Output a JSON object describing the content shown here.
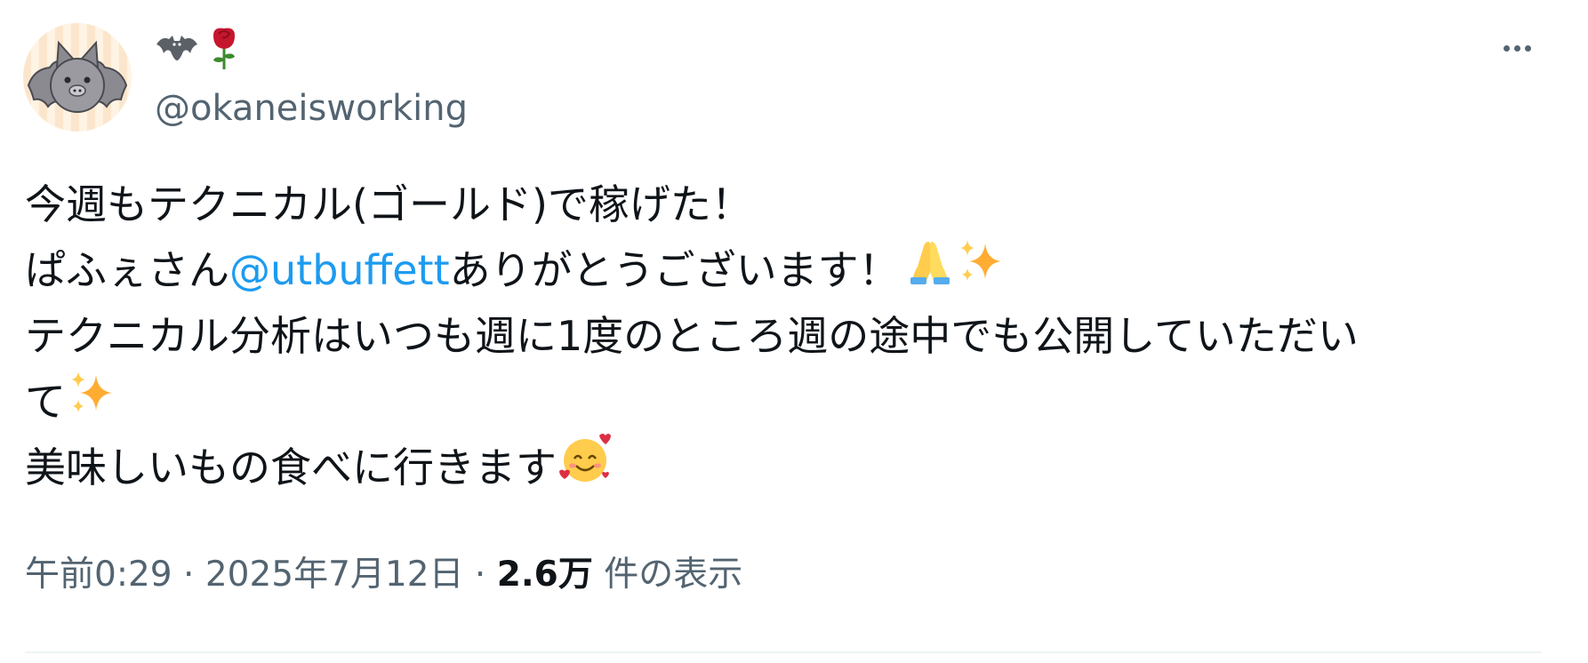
{
  "author": {
    "display_emoji": [
      "bat-emoji",
      "rose-emoji"
    ],
    "handle": "@okaneisworking",
    "avatar": "bat-avatar"
  },
  "tweet": {
    "line1": "今週もテクニカル(ゴールド)で稼げた！",
    "line2_prefix": "ぱふぇさん",
    "line2_mention": "@utbuffett",
    "line2_suffix": "ありがとうございます！",
    "line3": "テクニカル分析はいつも週に1度のところ週の途中でも公開していただい",
    "line4": "て",
    "line5": "美味しいもの食べに行きます",
    "emojis": [
      "folded-hands-emoji",
      "sparkles-emoji",
      "smiling-face-with-hearts-emoji"
    ]
  },
  "meta": {
    "time": "午前0:29",
    "separator": "·",
    "date": "2025年7月12日",
    "views_count": "2.6万",
    "views_label": "件の表示"
  },
  "colors": {
    "mention": "#1d9bf0",
    "secondary_text": "#536471",
    "primary_text": "#0f1419",
    "divider": "#eff3f4"
  }
}
